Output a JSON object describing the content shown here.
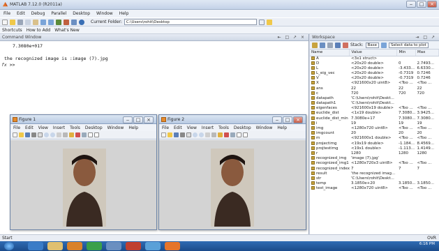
{
  "window": {
    "title": "MATLAB 7.12.0 (R2011a)"
  },
  "menu": [
    "File",
    "Edit",
    "Debug",
    "Parallel",
    "Desktop",
    "Window",
    "Help"
  ],
  "toolbar": {
    "current_folder_label": "Current Folder:",
    "current_folder_value": "C:\\Users\\rohit\\Desktop"
  },
  "shortcuts": {
    "shortcuts_label": "Shortcuts",
    "how_to_add": "How to Add",
    "whats_new": "What's New"
  },
  "command_window": {
    "title": "Command Window",
    "lines": [
      "7.3080e+017",
      "",
      "the recognized image is :image (7).jpg",
      ">>"
    ],
    "prompt_prefix": "fx"
  },
  "figures": [
    {
      "title": "Figure 1",
      "menu": [
        "File",
        "Edit",
        "View",
        "Insert",
        "Tools",
        "Desktop",
        "Window",
        "Help"
      ]
    },
    {
      "title": "Figure 2",
      "menu": [
        "File",
        "Edit",
        "View",
        "Insert",
        "Tools",
        "Desktop",
        "Window",
        "Help"
      ]
    }
  ],
  "workspace": {
    "title": "Workspace",
    "stack_label": "Stack:",
    "stack_value": "Base",
    "select_data_label": "Select data to plot",
    "columns": [
      "Name",
      "Value",
      "Min",
      "Max"
    ],
    "rows": [
      [
        "A",
        "<3x1 struct>",
        "",
        ""
      ],
      [
        "D",
        "<20x20 double>",
        "0",
        "2.7493..."
      ],
      [
        "L",
        "<20x20 double>",
        "-3.433...",
        "6.6330..."
      ],
      [
        "L_eig_vec",
        "<20x20 double>",
        "-0.7319",
        "0.7246"
      ],
      [
        "V",
        "<20x20 double>",
        "-0.7319",
        "0.7246"
      ],
      [
        "X",
        "<921600x20 uint8>",
        "<Too ...",
        "<Too ..."
      ],
      [
        "ans",
        "22",
        "22",
        "22"
      ],
      [
        "c",
        "720",
        "720",
        "720"
      ],
      [
        "datapath",
        "'C:\\Users\\rohit\\Deskt...",
        "",
        ""
      ],
      [
        "datapath1",
        "'C:\\Users\\rohit\\Deskt...",
        "",
        ""
      ],
      [
        "eigenfaces",
        "<921600x19 double>",
        "<Too ...",
        "<Too ..."
      ],
      [
        "euclide_dist",
        "<1x19 double>",
        "7.3080...",
        "3.9425..."
      ],
      [
        "euclide_dist_min",
        "7.3080e+17",
        "7.3080...",
        "7.3080..."
      ],
      [
        "i",
        "19",
        "19",
        "19"
      ],
      [
        "img",
        "<1280x720 uint8>",
        "<Too ...",
        "<Too ..."
      ],
      [
        "imgcount",
        "20",
        "20",
        "20"
      ],
      [
        "m",
        "<921600x1 double>",
        "<Too ...",
        "<Too ..."
      ],
      [
        "projectimg",
        "<19x19 double>",
        "-1.184...",
        "8.4569..."
      ],
      [
        "projtestimg",
        "<19x1 double>",
        "-1.113...",
        "1.4149..."
      ],
      [
        "r",
        "1280",
        "1280",
        "1280"
      ],
      [
        "recognized_img",
        "'image (7).jpg'",
        "",
        ""
      ],
      [
        "recognized_img1",
        "<1280x720x3 uint8>",
        "<Too ...",
        "<Too ..."
      ],
      [
        "recognized_index",
        "7",
        "7",
        "7"
      ],
      [
        "result",
        "'the recognized imag...",
        "",
        ""
      ],
      [
        "str",
        "'C:\\Users\\rohit\\Deskt...",
        "",
        ""
      ],
      [
        "temp",
        "3.1850e+20",
        "3.1850...",
        "3.1850..."
      ],
      [
        "test_image",
        "<1280x720 uint8>",
        "<Too ...",
        "<Too ..."
      ]
    ]
  },
  "status": {
    "start_label": "Start",
    "mode": "OVR"
  },
  "taskbar": {
    "time": "6:16 PM"
  },
  "colors": {
    "titlebar": "#c4d3e8",
    "taskbar": "#1b4b8a",
    "accent": "#e58b2d"
  }
}
